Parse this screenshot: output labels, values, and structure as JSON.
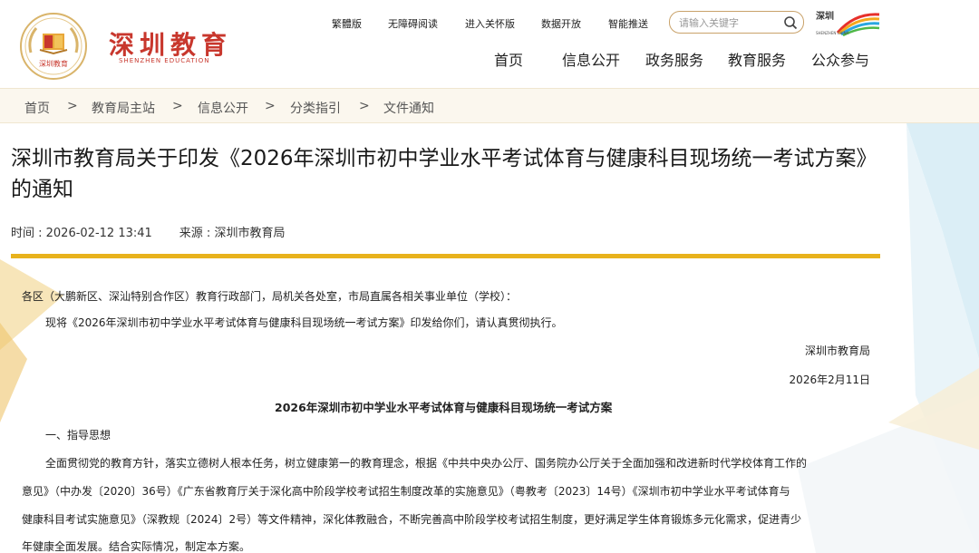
{
  "header": {
    "logo_text": "深圳教育",
    "logo_sub": "SHENZHEN EDUCATION",
    "logo_seal_text": "深圳教育",
    "top_links": [
      "繁體版",
      "无障碍阅读",
      "进入关怀版",
      "数据开放",
      "智能推送"
    ],
    "search": {
      "placeholder": "请输入关键字"
    },
    "city_logo_text": "深圳",
    "city_logo_sub": "SHENZHEN CHINA",
    "nav": [
      "首页",
      "信息公开",
      "政务服务",
      "教育服务",
      "公众参与"
    ]
  },
  "breadcrumb": {
    "items": [
      "首页",
      "教育局主站",
      "信息公开",
      "分类指引",
      "文件通知"
    ],
    "separator": ">"
  },
  "article": {
    "title": "深圳市教育局关于印发《2026年深圳市初中学业水平考试体育与健康科目现场统一考试方案》的通知",
    "time_label": "时间 : 2026-02-12 13:41",
    "source_label": "来源 : 深圳市教育局",
    "salutation": "各区（大鹏新区、深汕特别合作区）教育行政部门，局机关各处室，市局直属各相关事业单位（学校）：",
    "intro": "现将《2026年深圳市初中学业水平考试体育与健康科目现场统一考试方案》印发给你们，请认真贯彻执行。",
    "signature": "深圳市教育局",
    "date": "2026年2月11日",
    "doc_title": "2026年深圳市初中学业水平考试体育与健康科目现场统一考试方案",
    "section1": "一、指导思想",
    "para_lines": [
      "全面贯彻党的教育方针，落实立德树人根本任务，树立健康第一的教育理念，根据《中共中央办公厅、国务院办公厅关于全面加强和改进新时代学校体育工作的",
      "意见》（中办发〔2020〕36号）《广东省教育厅关于深化高中阶段学校考试招生制度改革的实施意见》（粤教考〔2023〕14号）《深圳市初中学业水平考试体育与",
      "健康科目考试实施意见》（深教规〔2024〕2号）等文件精神，深化体教融合，不断完善高中阶段学校考试招生制度，更好满足学生体育锻炼多元化需求，促进青少",
      "年健康全面发展。结合实际情况，制定本方案。"
    ]
  },
  "colors": {
    "brand_red": "#c8372d",
    "gold": "#e8b21c",
    "crumb_bg": "#fbf7ee"
  }
}
